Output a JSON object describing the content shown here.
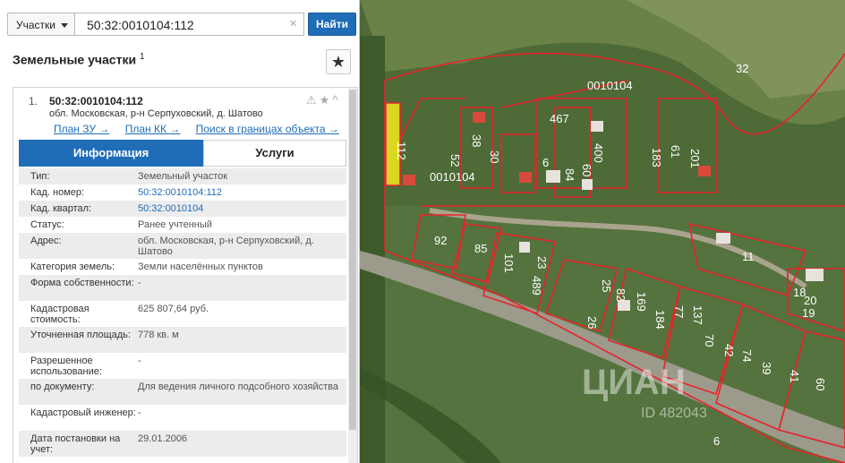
{
  "search": {
    "type_label": "Участки",
    "query": "50:32:0010104:112",
    "clear_symbol": "×",
    "find_label": "Найти"
  },
  "section": {
    "title": "Земельные участки",
    "count_sup": "1",
    "star_symbol": "★"
  },
  "result": {
    "index": "1.",
    "cad_number": "50:32:0010104:112",
    "address": "обл. Московская, р-н Серпуховский, д. Шатово",
    "icons": "⚠★^",
    "links": [
      "План ЗУ →",
      "План КК →",
      "Поиск в границах объекта →"
    ],
    "tabs": [
      "Информация",
      "Услуги"
    ],
    "rows": [
      {
        "key": "Тип:",
        "value": "Земельный участок"
      },
      {
        "key": "Кад. номер:",
        "value": "50:32:0010104:112",
        "link": true
      },
      {
        "key": "Кад. квартал:",
        "value": "50:32:0010104",
        "link": true
      },
      {
        "key": "Статус:",
        "value": "Ранее учтенный"
      },
      {
        "key": "Адрес:",
        "value": "обл. Московская, р-н Серпуховский, д. Шатово"
      },
      {
        "key": "Категория земель:",
        "value": "Земли населённых пунктов"
      },
      {
        "key": "Форма собственности:",
        "value": "-"
      },
      {
        "key": "Кадастровая стоимость:",
        "value": "625 807,64 руб."
      },
      {
        "key": "Уточненная площадь:",
        "value": "778 кв. м"
      },
      {
        "key": "Разрешенное использование:",
        "value": "-"
      },
      {
        "key": "по документу:",
        "value": "Для ведения личного подсобного хозяйства"
      },
      {
        "key": "Кадастровый инженер:",
        "value": "-"
      },
      {
        "key": "Дата постановки на учет:",
        "value": "29.01.2006"
      }
    ]
  },
  "map": {
    "labels": [
      "32",
      "0010104",
      "0010104",
      "467",
      "112",
      "38",
      "30",
      "52",
      "6",
      "84",
      "60",
      "400",
      "183",
      "61",
      "201",
      "92",
      "85",
      "101",
      "23",
      "489",
      "25",
      "26",
      "82",
      "169",
      "184",
      "77",
      "137",
      "70",
      "42",
      "74",
      "39",
      "41",
      "60",
      "11",
      "18",
      "20",
      "19",
      "6"
    ],
    "watermark": "ЦИАН",
    "watermark_id": "ID 482043"
  }
}
